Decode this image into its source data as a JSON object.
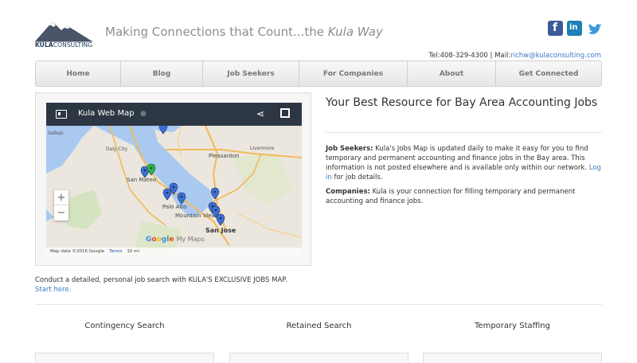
{
  "brand": {
    "logo_name": "KULA",
    "logo_suffix": "CONSULTING",
    "tagline_prefix": "Making Connections that Count...the ",
    "tagline_emphasis": "Kula Way"
  },
  "social": [
    {
      "name": "facebook-icon",
      "glyph": "f"
    },
    {
      "name": "linkedin-icon",
      "glyph": "in"
    },
    {
      "name": "twitter-icon",
      "glyph": ""
    }
  ],
  "contact": {
    "phone_label": "Tel:408-329-4300 | Mail:",
    "email": "richw@kulaconsulting.com"
  },
  "nav": [
    {
      "label": "Home",
      "name": "nav-home"
    },
    {
      "label": "Blog",
      "name": "nav-blog"
    },
    {
      "label": "Job Seekers",
      "name": "nav-job-seekers"
    },
    {
      "label": "For Companies",
      "name": "nav-for-companies"
    },
    {
      "label": "About",
      "name": "nav-about"
    },
    {
      "label": "Get Connected",
      "name": "nav-get-connected"
    }
  ],
  "map": {
    "title": "Kula Web Map",
    "labels": [
      "Vallejo",
      "Daly City",
      "San Mateo",
      "Pleasanton",
      "Palo Alto",
      "Mountain View",
      "San Jose",
      "Livermore"
    ],
    "google_text": "Google",
    "my_maps": "My Maps",
    "map_data": "Map data ©2016 Google",
    "terms": "Terms",
    "scale": "10 mi",
    "zoom_in": "+",
    "zoom_out": "−"
  },
  "content": {
    "heading": "Your Best Resource for Bay Area Accounting Jobs",
    "p1_label": "Job Seekers:",
    "p1_text": " Kula's Jobs Map is updated daily to make it easy for you to find temporary and permanent accounting and finance jobs in the Bay area. This information is not posted elsewhere and is available only within our network. ",
    "p1_link": "Log in",
    "p1_tail": " for job details.",
    "p2_label": "Companies:",
    "p2_text": " Kula is your connection for filling temporary and permanent accounting and finance jobs.",
    "under_map_text": "Conduct a detailed, personal job search with KULA'S EXCLUSIVE JOBS MAP.",
    "under_map_link": "Start here."
  },
  "services": [
    {
      "title": "Contingency Search"
    },
    {
      "title": "Retained Search"
    },
    {
      "title": "Temporary Staffing"
    }
  ],
  "colors": {
    "link": "#3a7cc2",
    "facebook": "#3b5a9a",
    "linkedin": "#1e80b4",
    "twitter": "#3a9ad9",
    "map_bar": "#2d3743",
    "pin": "#3d6fd6",
    "pin_alt": "#2fb14a"
  }
}
